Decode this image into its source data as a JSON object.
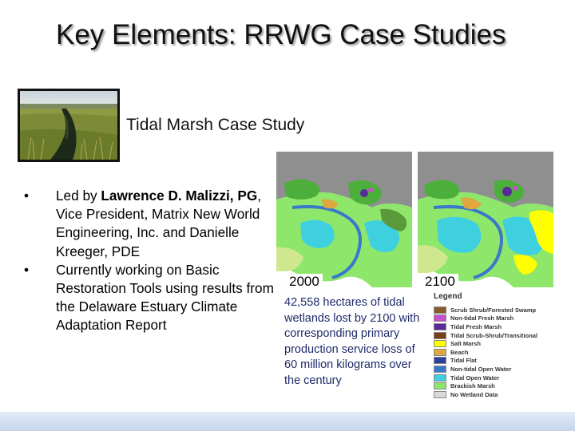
{
  "slide": {
    "title": "Key Elements: RRWG Case Studies",
    "subtitle": "Tidal Marsh Case Study",
    "bullets": [
      {
        "marker": "•",
        "parts": [
          {
            "text": "Led by ",
            "bold": false
          },
          {
            "text": "Lawrence D. Malizzi, PG",
            "bold": true
          },
          {
            "text": ", Vice President, Matrix New World Engineering, Inc. and Danielle Kreeger, PDE",
            "bold": false
          }
        ]
      },
      {
        "marker": "•",
        "parts": [
          {
            "text": "Currently working on Basic Restoration Tools using results from the Delaware Estuary Climate Adaptation Report",
            "bold": false
          }
        ]
      }
    ],
    "maps": [
      {
        "year": "2000"
      },
      {
        "year": "2100"
      }
    ],
    "stat_text": "42,558 hectares of tidal wetlands lost by 2100 with corresponding primary production service loss of 60 million kilograms over the century",
    "legend": {
      "title": "Legend",
      "items": [
        {
          "label": "Scrub Shrub/Forested Swamp",
          "color": "#8b5a2b"
        },
        {
          "label": "Non-tidal Fresh Marsh",
          "color": "#c84fd0"
        },
        {
          "label": "Tidal Fresh Marsh",
          "color": "#5a2a9a"
        },
        {
          "label": "Tidal Scrub-Shrub/Transitional",
          "color": "#7a3e14"
        },
        {
          "label": "Salt Marsh",
          "color": "#ffff00"
        },
        {
          "label": "Beach",
          "color": "#e0a640"
        },
        {
          "label": "Tidal Flat",
          "color": "#2e3f9e"
        },
        {
          "label": "Non-tidal Open Water",
          "color": "#3a78c9"
        },
        {
          "label": "Tidal Open Water",
          "color": "#3fd0e0"
        },
        {
          "label": "Brackish Marsh",
          "color": "#8ee66a"
        },
        {
          "label": "No Wetland Data",
          "color": "#d9d9d9"
        }
      ]
    }
  }
}
